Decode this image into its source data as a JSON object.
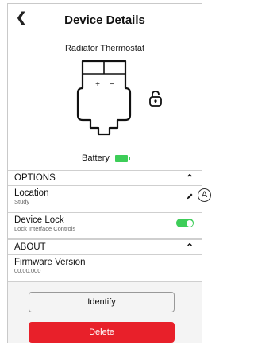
{
  "header": {
    "back_icon": "chevron-left-icon",
    "title": "Device Details"
  },
  "device": {
    "name": "Radiator Thermostat",
    "plus_label": "+",
    "minus_label": "−",
    "lock_icon": "unlock-icon"
  },
  "battery": {
    "label": "Battery",
    "icon": "battery-full-icon",
    "color": "#3dcd58"
  },
  "options": {
    "label": "OPTIONS",
    "items": [
      {
        "label": "Location",
        "sublabel": "Study",
        "icon": "edit-pencil-icon"
      },
      {
        "label": "Device Lock",
        "sublabel": "Lock Interface Controls",
        "toggle_on": true
      }
    ]
  },
  "about": {
    "label": "ABOUT",
    "items": [
      {
        "label": "Firmware Version",
        "sublabel": "00.00.000"
      }
    ]
  },
  "buttons": {
    "identify": "Identify",
    "delete": "Delete",
    "delete_color": "#e8202a"
  },
  "callout": {
    "label": "A"
  }
}
